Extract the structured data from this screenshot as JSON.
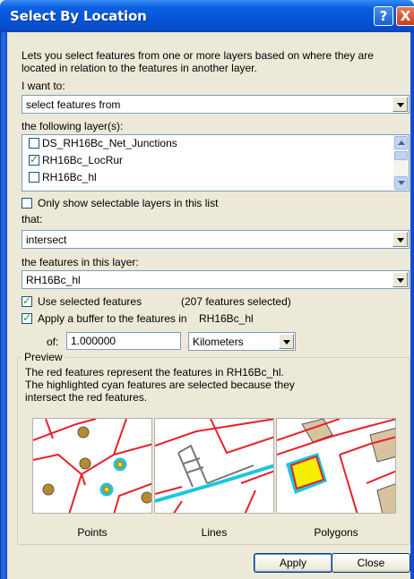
{
  "window": {
    "title": "Select By Location",
    "help_glyph": "?",
    "close_glyph": "X"
  },
  "intro_text": "Lets you select features from one or more layers based on where they are located in relation to the features in another layer.",
  "method": {
    "label": "I want to:",
    "value": "select features from"
  },
  "layers": {
    "label": "the following layer(s):",
    "items": [
      {
        "label": "DS_RH16Bc_Net_Junctions",
        "checked": false
      },
      {
        "label": "RH16Bc_LocRur",
        "checked": true
      },
      {
        "label": "RH16Bc_hl",
        "checked": false
      }
    ]
  },
  "only_selectable": {
    "label": "Only show selectable layers in this list",
    "checked": false
  },
  "relation": {
    "label": "that:",
    "value": "intersect"
  },
  "source": {
    "label": "the features in this layer:",
    "value": "RH16Bc_hl"
  },
  "use_selected": {
    "label": "Use selected features",
    "checked": true,
    "count_text": "(207 features selected)"
  },
  "buffer": {
    "label": "Apply a buffer to the features in",
    "layer": "RH16Bc_hl",
    "checked": true,
    "of_label": "of:",
    "distance": "1.000000",
    "units": "Kilometers"
  },
  "preview": {
    "legend": "Preview",
    "line1": "The red features represent the features in RH16Bc_hl.",
    "line2": "The highlighted cyan features are selected because they",
    "line3": "intersect the red features.",
    "captions": [
      "Points",
      "Lines",
      "Polygons"
    ]
  },
  "buttons": {
    "apply": "Apply",
    "close": "Close"
  },
  "colors": {
    "title_bar": "#0552d6",
    "dialog_bg": "#ece9d8",
    "red_feature": "#e8202a",
    "cyan_selection": "#19c7e0",
    "point_fill": "#b88a2a",
    "polygon_fill": "#d8c3a0",
    "highlight_fill": "#f4f000"
  },
  "icons": [
    "help-icon",
    "close-icon",
    "dropdown-arrow-icon",
    "checkbox-icon",
    "scroll-up-icon",
    "scroll-down-icon"
  ]
}
